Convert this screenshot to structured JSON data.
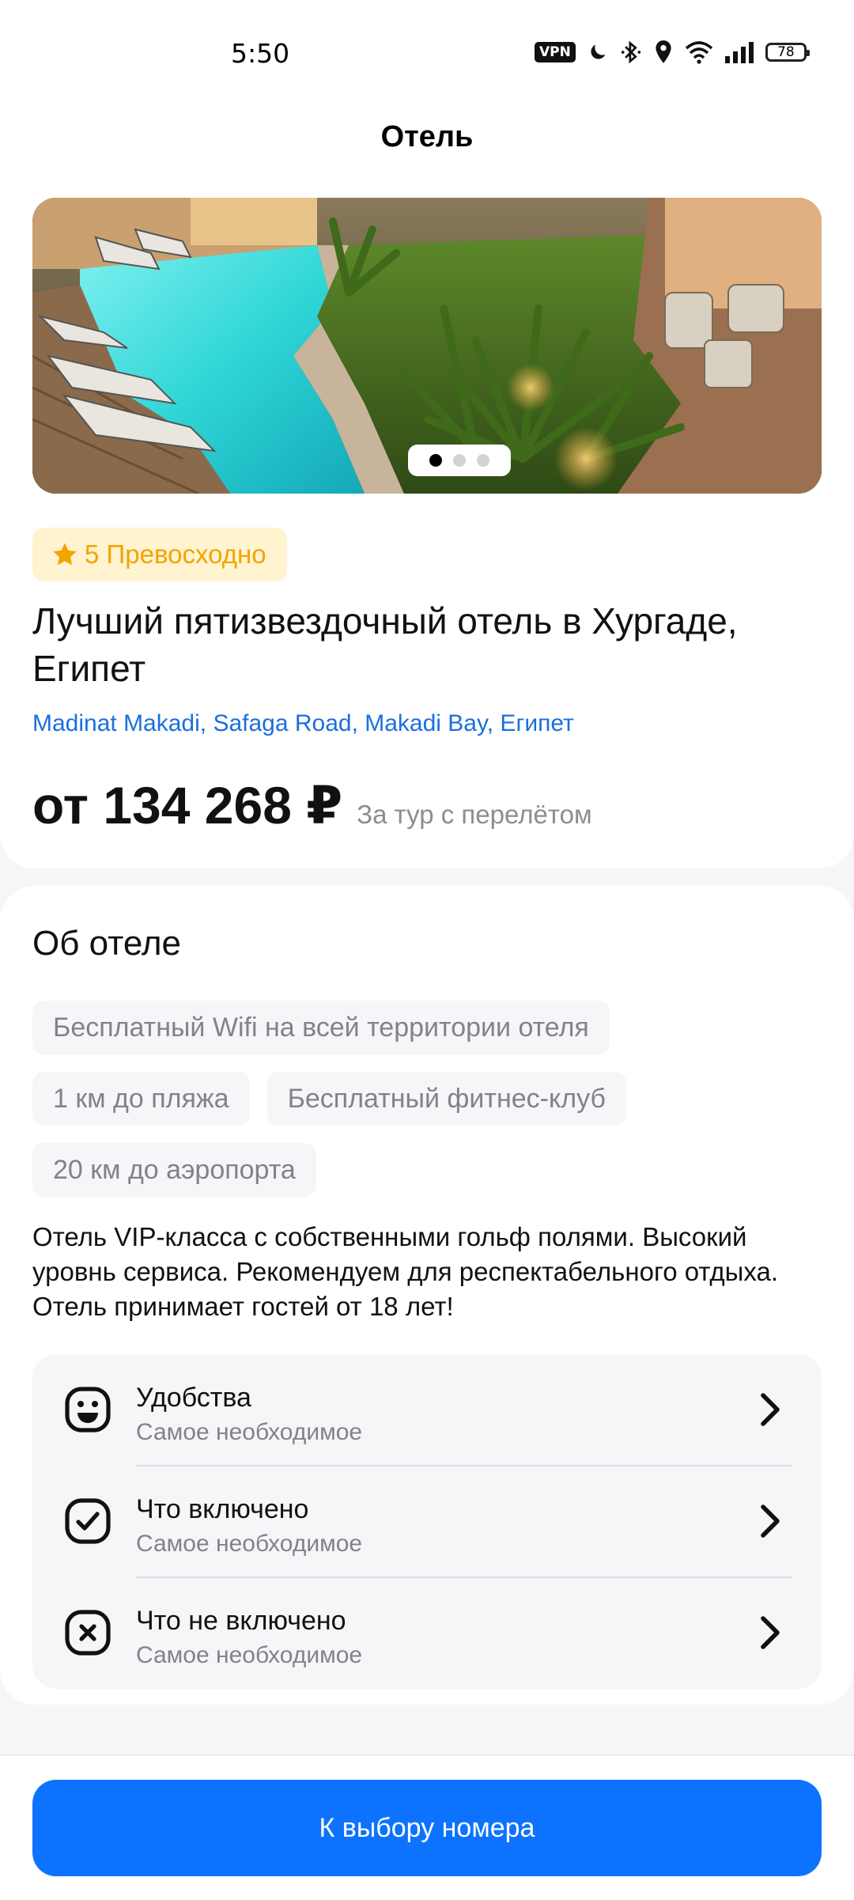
{
  "status_bar": {
    "time": "5:50",
    "vpn": "VPN",
    "battery": "78",
    "icons": [
      "moon-icon",
      "bluetooth-icon",
      "location-icon",
      "wifi-icon",
      "signal-icon",
      "battery-icon"
    ]
  },
  "header": {
    "title": "Отель"
  },
  "hotel": {
    "gallery": {
      "page_count": 3,
      "active_page": 1
    },
    "rating_label": "5 Превосходно",
    "name": "Лучший пятизвездочный отель в Хургаде, Египет",
    "address": "Madinat Makadi, Safaga Road, Makadi Bay, Египет",
    "price": "от 134 268 ₽",
    "price_note": "За тур с перелётом"
  },
  "about": {
    "title": "Об отеле",
    "tags": [
      "Бесплатный Wifi на всей территории отеля",
      "1 км до пляжа",
      "Бесплатный фитнес-клуб",
      "20 км до аэропорта"
    ],
    "description": "Отель VIP-класса с собственными гольф полями. Высокий уровнь сервиса. Рекомендуем для респектабельного отдыха. Отель принимает гостей от 18 лет!",
    "items": [
      {
        "title": "Удобства",
        "subtitle": "Самое необходимое",
        "icon": "emoji-happy-icon"
      },
      {
        "title": "Что включено",
        "subtitle": "Самое необходимое",
        "icon": "tick-square-icon"
      },
      {
        "title": "Что не включено",
        "subtitle": "Самое необходимое",
        "icon": "close-square-icon"
      }
    ]
  },
  "footer": {
    "cta_label": "К выбору номера"
  },
  "colors": {
    "accent": "#0d73fe",
    "link": "#1a6fe0",
    "rating_text": "#f3a400",
    "rating_bg": "#fff3d0",
    "muted": "#80838a"
  }
}
